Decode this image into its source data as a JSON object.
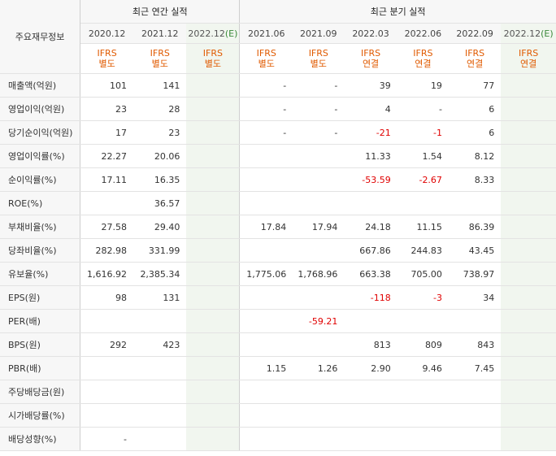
{
  "header": {
    "corner_label": "주요재무정보",
    "annual_title": "최근 연간 실적",
    "quarter_title": "최근 분기 실적",
    "annual_dates": [
      "2020.12",
      "2021.12",
      "2022.12"
    ],
    "annual_est_suffix": "(E)",
    "quarter_dates": [
      "2021.06",
      "2021.09",
      "2022.03",
      "2022.06",
      "2022.09",
      "2022.12"
    ],
    "quarter_est_suffix": "(E)",
    "annual_types": [
      {
        "std": "IFRS",
        "kind": "별도"
      },
      {
        "std": "IFRS",
        "kind": "별도"
      },
      {
        "std": "IFRS",
        "kind": "별도"
      }
    ],
    "quarter_types": [
      {
        "std": "IFRS",
        "kind": "별도"
      },
      {
        "std": "IFRS",
        "kind": "별도"
      },
      {
        "std": "IFRS",
        "kind": "연결"
      },
      {
        "std": "IFRS",
        "kind": "연결"
      },
      {
        "std": "IFRS",
        "kind": "연결"
      },
      {
        "std": "IFRS",
        "kind": "연결"
      }
    ]
  },
  "rows": [
    {
      "label": "매출액(억원)",
      "values": [
        "101",
        "141",
        "",
        "-",
        "-",
        "39",
        "19",
        "77",
        ""
      ]
    },
    {
      "label": "영업이익(억원)",
      "values": [
        "23",
        "28",
        "",
        "-",
        "-",
        "4",
        "-",
        "6",
        ""
      ]
    },
    {
      "label": "당기순이익(억원)",
      "values": [
        "17",
        "23",
        "",
        "-",
        "-",
        "-21",
        "-1",
        "6",
        ""
      ]
    },
    {
      "label": "영업이익률(%)",
      "values": [
        "22.27",
        "20.06",
        "",
        "",
        "",
        "11.33",
        "1.54",
        "8.12",
        ""
      ]
    },
    {
      "label": "순이익률(%)",
      "values": [
        "17.11",
        "16.35",
        "",
        "",
        "",
        "-53.59",
        "-2.67",
        "8.33",
        ""
      ]
    },
    {
      "label": "ROE(%)",
      "values": [
        "",
        "36.57",
        "",
        "",
        "",
        "",
        "",
        "",
        ""
      ]
    },
    {
      "label": "부채비율(%)",
      "values": [
        "27.58",
        "29.40",
        "",
        "17.84",
        "17.94",
        "24.18",
        "11.15",
        "86.39",
        ""
      ]
    },
    {
      "label": "당좌비율(%)",
      "values": [
        "282.98",
        "331.99",
        "",
        "",
        "",
        "667.86",
        "244.83",
        "43.45",
        ""
      ]
    },
    {
      "label": "유보율(%)",
      "values": [
        "1,616.92",
        "2,385.34",
        "",
        "1,775.06",
        "1,768.96",
        "663.38",
        "705.00",
        "738.97",
        ""
      ]
    },
    {
      "label": "EPS(원)",
      "values": [
        "98",
        "131",
        "",
        "",
        "",
        "-118",
        "-3",
        "34",
        ""
      ]
    },
    {
      "label": "PER(배)",
      "values": [
        "",
        "",
        "",
        "",
        "-59.21",
        "",
        "",
        "",
        ""
      ]
    },
    {
      "label": "BPS(원)",
      "values": [
        "292",
        "423",
        "",
        "",
        "",
        "813",
        "809",
        "843",
        ""
      ]
    },
    {
      "label": "PBR(배)",
      "values": [
        "",
        "",
        "",
        "1.15",
        "1.26",
        "2.90",
        "9.46",
        "7.45",
        ""
      ]
    },
    {
      "label": "주당배당금(원)",
      "values": [
        "",
        "",
        "",
        "",
        "",
        "",
        "",
        "",
        ""
      ]
    },
    {
      "label": "시가배당률(%)",
      "values": [
        "",
        "",
        "",
        "",
        "",
        "",
        "",
        "",
        ""
      ]
    },
    {
      "label": "배당성향(%)",
      "values": [
        "-",
        "",
        "",
        "",
        "",
        "",
        "",
        "",
        ""
      ]
    }
  ],
  "colors": {
    "type_text": "#e05a00",
    "negative": "#e00000",
    "estimate_bg": "#f1f6ef"
  }
}
